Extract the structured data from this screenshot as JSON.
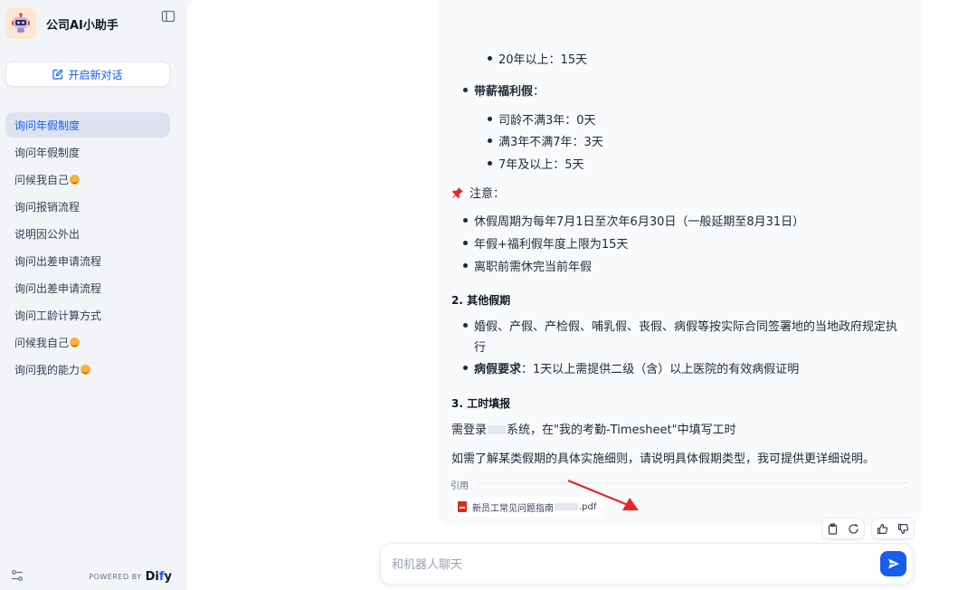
{
  "app": {
    "title": "公司AI小助手"
  },
  "sidebar": {
    "new_chat_label": "开启新对话",
    "conversations": [
      {
        "label": "询问年假制度"
      },
      {
        "label": "询问年假制度"
      },
      {
        "label": "问候我自己"
      },
      {
        "label": "询问报销流程"
      },
      {
        "label": "说明因公外出"
      },
      {
        "label": "询问出差申请流程"
      },
      {
        "label": "询问出差申请流程"
      },
      {
        "label": "询问工龄计算方式"
      },
      {
        "label": "问候我自己"
      },
      {
        "label": "询问我的能力"
      }
    ],
    "powered_by": "POWERED BY",
    "brand_prefix": "Di",
    "brand_accent": "f",
    "brand_suffix": "y"
  },
  "answer": {
    "line_20y": "20年以上：15天",
    "paid_welfare_label": "带薪福利假",
    "colon": "：",
    "w1": "司龄不满3年：0天",
    "w2": "满3年不满7年：3天",
    "w3": "7年及以上：5天",
    "notice_label": "注意：",
    "n1": "休假周期为每年7月1日至次年6月30日（一般延期至8月31日）",
    "n2": "年假+福利假年度上限为15天",
    "n3": "离职前需休完当前年假",
    "h2": "2. 其他假期",
    "o1_line1": "婚假、产假、产检假、哺乳假、丧假、病假等按实际合同签署地的当地政府规定执",
    "o1_line2": "行",
    "o2_label": "病假要求",
    "o2_text": "：1天以上需提供二级（含）以上医院的有效病假证明",
    "h3": "3. 工时填报",
    "t1_pre": "需登录",
    "t1_post": "系统，在\"我的考勤-Timesheet\"中填写工时",
    "closing": "如需了解某类假期的具体实施细则，请说明具体假期类型，我可提供更详细说明。",
    "citation_label": "引用",
    "citation_file_pre": "新员工常见问题指南",
    "citation_file_post": ".pdf"
  },
  "input": {
    "placeholder": "和机器人聊天"
  },
  "colors": {
    "accent": "#155eef",
    "annotation_arrow": "#e8262a",
    "pdf": "#d92d20"
  }
}
